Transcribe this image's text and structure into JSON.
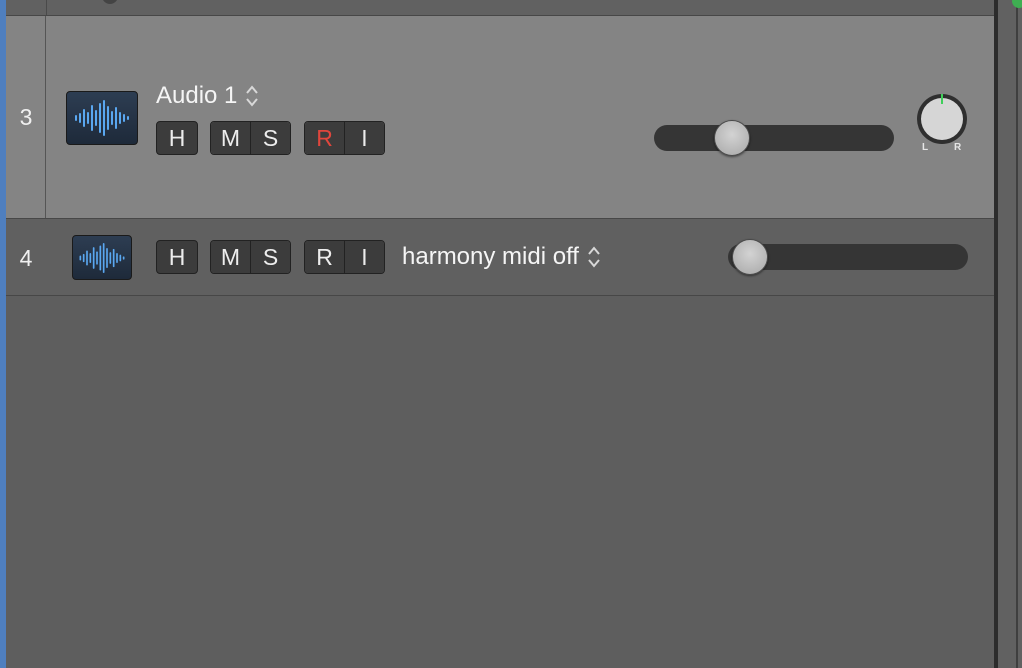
{
  "tracks": [
    {
      "number": "3",
      "name": "Audio 1",
      "selected": true,
      "buttons": {
        "hide": "H",
        "mute": "M",
        "solo": "S",
        "record": "R",
        "input": "I"
      },
      "record_armed": true,
      "volume_level": 0.33,
      "pan_labels": {
        "left": "L",
        "right": "R"
      },
      "icon": "audio-waveform-icon"
    },
    {
      "number": "4",
      "name": "harmony midi off",
      "selected": false,
      "buttons": {
        "hide": "H",
        "mute": "M",
        "solo": "S",
        "record": "R",
        "input": "I"
      },
      "record_armed": false,
      "volume_level": 0.0,
      "icon": "audio-waveform-icon"
    }
  ],
  "colors": {
    "selection_edge": "#4f7fbf",
    "record_armed": "#e0463c",
    "waveform": "#5aa7f0",
    "pan_indicator": "#3fcf5a"
  }
}
